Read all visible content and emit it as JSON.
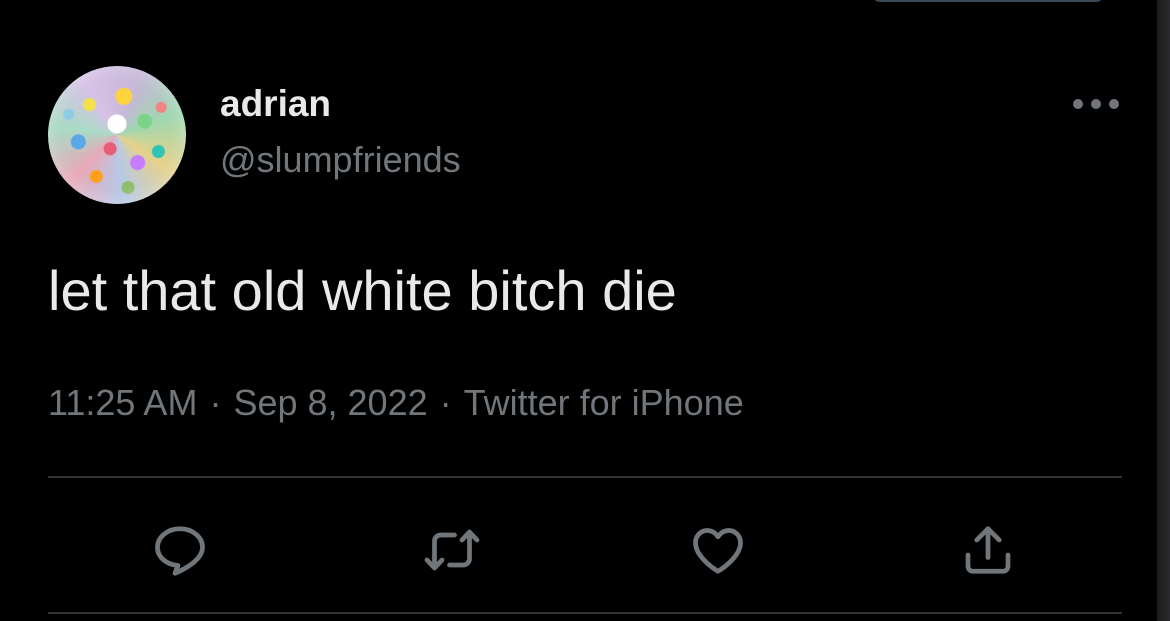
{
  "tweet": {
    "author": {
      "display_name": "adrian",
      "handle": "@slumpfriends"
    },
    "text": "let that old white bitch die",
    "time": "11:25 AM",
    "date": "Sep 8, 2022",
    "source": "Twitter for iPhone",
    "separator": "·"
  },
  "icons": {
    "more": "more-horizontal-icon",
    "reply": "reply-icon",
    "retweet": "retweet-icon",
    "like": "heart-icon",
    "share": "share-icon"
  },
  "colors": {
    "background": "#000000",
    "primary_text": "#e7e9ea",
    "secondary_text": "#71767b",
    "divider": "#2f3336"
  }
}
